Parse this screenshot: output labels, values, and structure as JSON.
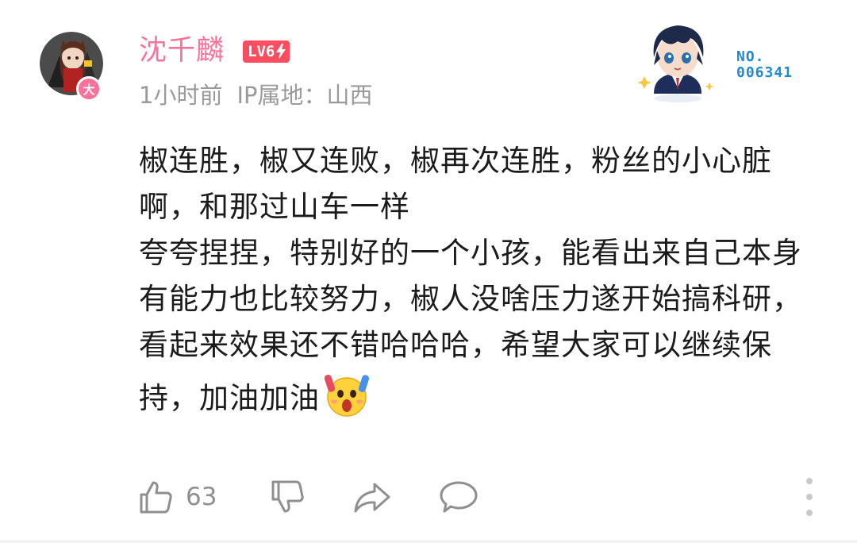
{
  "user": {
    "name": "沈千麟",
    "level": "LV6",
    "badge_char": "大",
    "time": "1小时前",
    "ip_location": "IP属地：山西"
  },
  "decoration": {
    "number_line1": "NO.",
    "number_line2": "006341"
  },
  "comment": {
    "paragraph1": "椒连胜，椒又连败，椒再次连胜，粉丝的小心脏啊，和那过山车一样",
    "paragraph2": "夸夸捏捏，特别好的一个小孩，能看出来自己本身有能力也比较努力，椒人没啥压力遂开始搞科研，看起来效果还不错哈哈哈，希望大家可以继续保持，加油加油"
  },
  "actions": {
    "like_count": "63"
  },
  "colors": {
    "username": "#fb7299",
    "level_badge": "#fb4d5f",
    "meta_text": "#9a9a9a",
    "deco_number": "#1e8ad6",
    "icon_stroke": "#8f8f8f"
  },
  "icons": [
    "avatar",
    "fan-badge-icon",
    "level-lightning-icon",
    "deco-avatar",
    "scream-emoji-icon",
    "thumbs-up-icon",
    "thumbs-down-icon",
    "share-icon",
    "comment-icon",
    "more-vertical-icon"
  ]
}
